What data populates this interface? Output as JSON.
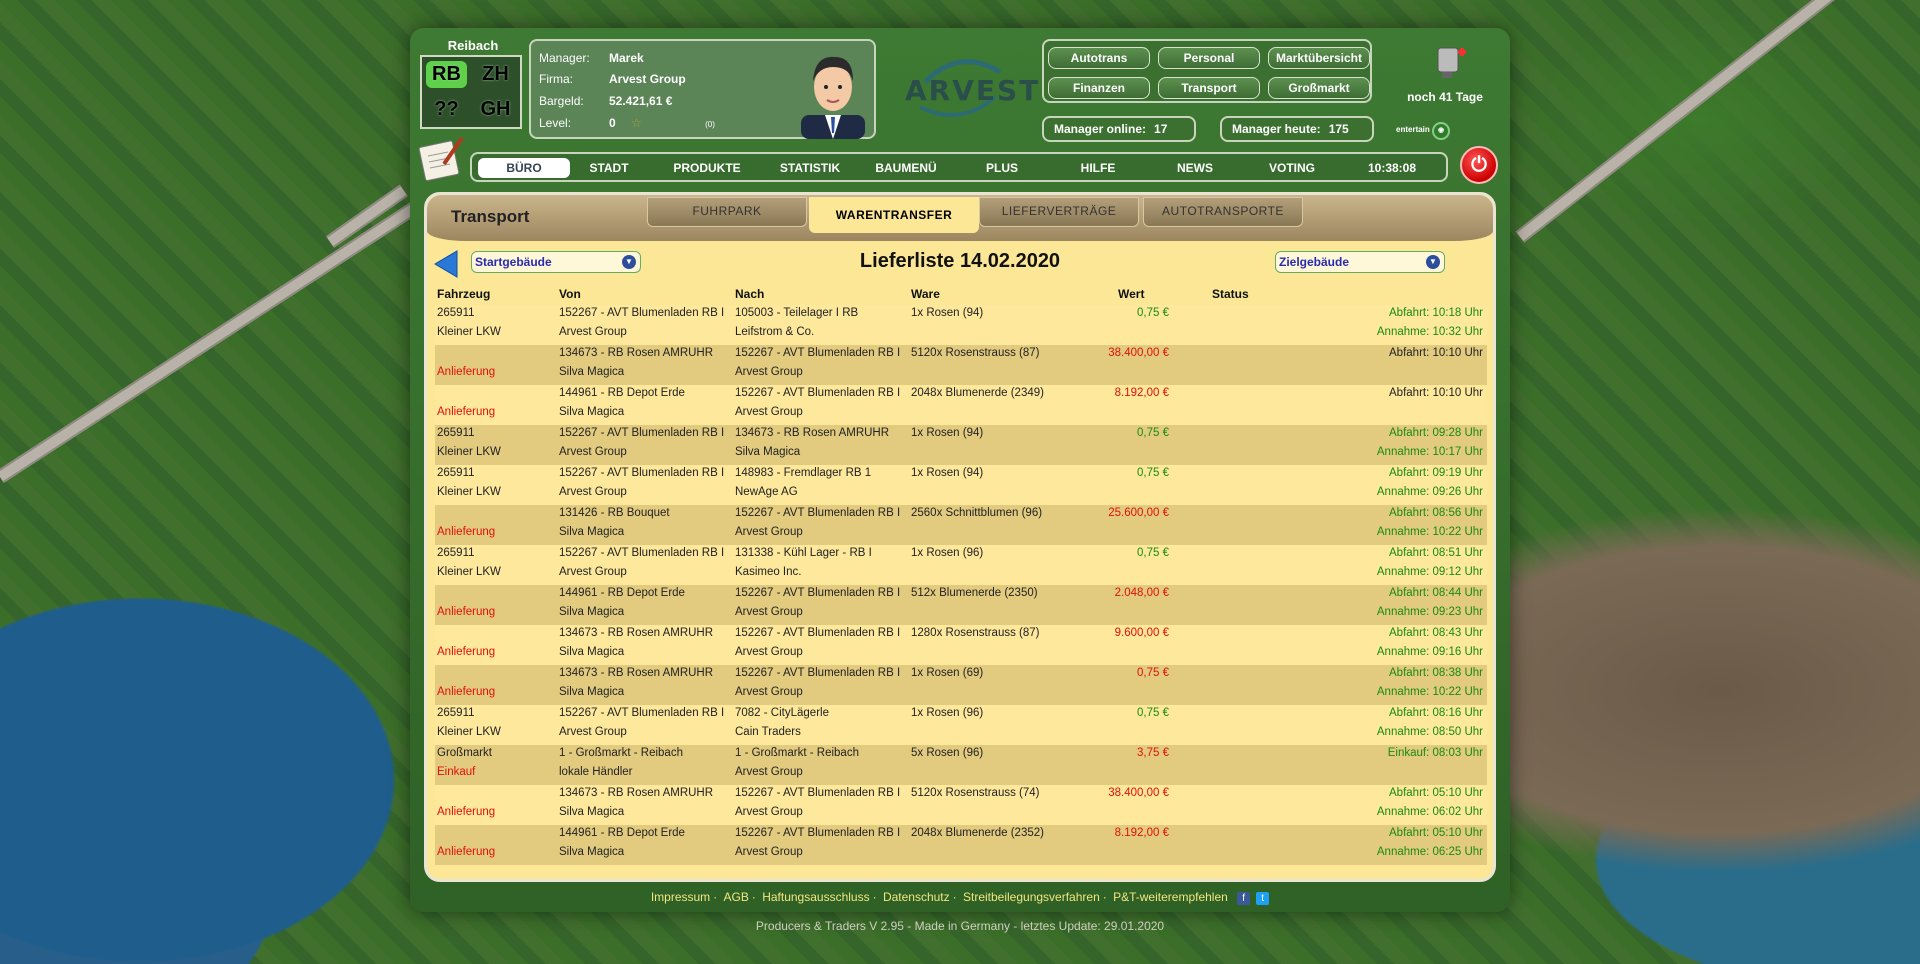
{
  "header": {
    "city": "Reibach",
    "city_grid": [
      "RB",
      "ZH",
      "??",
      "GH"
    ],
    "manager_label": "Manager:",
    "manager": "Marek",
    "company_label": "Firma:",
    "company": "Arvest Group",
    "cash_label": "Bargeld:",
    "cash": "52.421,61 €",
    "level_label": "Level:",
    "level": "0",
    "level_sub": "(0)",
    "logo_text": "ARVEST",
    "top_buttons": [
      "Autotrans",
      "Personal",
      "Marktübersicht",
      "Finanzen",
      "Transport",
      "Großmarkt"
    ],
    "online_label": "Manager online:",
    "online_value": "17",
    "today_label": "Manager heute:",
    "today_value": "175",
    "days_left": "noch 41 Tage",
    "entertain": "entertain"
  },
  "menu": {
    "items": [
      "BÜRO",
      "STADT",
      "PRODUKTE",
      "STATISTIK",
      "BAUMENÜ",
      "PLUS",
      "HILFE",
      "NEWS",
      "VOTING"
    ],
    "clock": "10:38:08"
  },
  "panel": {
    "title": "Transport",
    "tabs": [
      "FUHRPARK",
      "WARENTRANSFER",
      "LIEFERVERTRÄGE",
      "AUTOTRANSPORTE"
    ],
    "start_dropdown": "Startgebäude",
    "target_dropdown": "Zielgebäude",
    "list_title": "Lieferliste 14.02.2020",
    "columns": [
      "Fahrzeug",
      "Von",
      "Nach",
      "Ware",
      "Wert",
      "Status"
    ]
  },
  "rows": [
    {
      "f1": "265911",
      "f2": "Kleiner LKW",
      "v1": "152267 - AVT Blumenladen RB I",
      "v2": "Arvest Group",
      "n1": "105003 - Teilelager I RB",
      "n2": "Leifstrom & Co.",
      "ware": "1x Rosen (94)",
      "wert": "0,75 €",
      "s1": "Abfahrt: 10:18 Uhr",
      "s2": "Annahme: 10:32 Uhr",
      "wc": "green",
      "s1c": "green",
      "s2c": "green",
      "f2c": ""
    },
    {
      "f1": "",
      "f2": "Anlieferung",
      "v1": "134673 - RB Rosen AMRUHR",
      "v2": "Silva Magica",
      "n1": "152267 - AVT Blumenladen RB I",
      "n2": "Arvest Group",
      "ware": "5120x Rosenstrauss (87)",
      "wert": "38.400,00 €",
      "s1": "Abfahrt: 10:10 Uhr",
      "s2": "",
      "wc": "red",
      "s1c": "",
      "s2c": "",
      "f2c": "red"
    },
    {
      "f1": "",
      "f2": "Anlieferung",
      "v1": "144961 - RB Depot Erde",
      "v2": "Silva Magica",
      "n1": "152267 - AVT Blumenladen RB I",
      "n2": "Arvest Group",
      "ware": "2048x Blumenerde (2349)",
      "wert": "8.192,00 €",
      "s1": "Abfahrt: 10:10 Uhr",
      "s2": "",
      "wc": "red",
      "s1c": "",
      "s2c": "",
      "f2c": "red"
    },
    {
      "f1": "265911",
      "f2": "Kleiner LKW",
      "v1": "152267 - AVT Blumenladen RB I",
      "v2": "Arvest Group",
      "n1": "134673 - RB Rosen AMRUHR",
      "n2": "Silva Magica",
      "ware": "1x Rosen (94)",
      "wert": "0,75 €",
      "s1": "Abfahrt: 09:28 Uhr",
      "s2": "Annahme: 10:17 Uhr",
      "wc": "green",
      "s1c": "green",
      "s2c": "green",
      "f2c": ""
    },
    {
      "f1": "265911",
      "f2": "Kleiner LKW",
      "v1": "152267 - AVT Blumenladen RB I",
      "v2": "Arvest Group",
      "n1": "148983 - Fremdlager RB 1",
      "n2": "NewAge AG",
      "ware": "1x Rosen (94)",
      "wert": "0,75 €",
      "s1": "Abfahrt: 09:19 Uhr",
      "s2": "Annahme: 09:26 Uhr",
      "wc": "green",
      "s1c": "green",
      "s2c": "green",
      "f2c": ""
    },
    {
      "f1": "",
      "f2": "Anlieferung",
      "v1": "131426 - RB Bouquet",
      "v2": "Silva Magica",
      "n1": "152267 - AVT Blumenladen RB I",
      "n2": "Arvest Group",
      "ware": "2560x Schnittblumen (96)",
      "wert": "25.600,00 €",
      "s1": "Abfahrt: 08:56 Uhr",
      "s2": "Annahme: 10:22 Uhr",
      "wc": "red",
      "s1c": "green",
      "s2c": "green",
      "f2c": "red"
    },
    {
      "f1": "265911",
      "f2": "Kleiner LKW",
      "v1": "152267 - AVT Blumenladen RB I",
      "v2": "Arvest Group",
      "n1": "131338 - Kühl Lager - RB I",
      "n2": "Kasimeo Inc.",
      "ware": "1x Rosen (96)",
      "wert": "0,75 €",
      "s1": "Abfahrt: 08:51 Uhr",
      "s2": "Annahme: 09:12 Uhr",
      "wc": "green",
      "s1c": "green",
      "s2c": "green",
      "f2c": ""
    },
    {
      "f1": "",
      "f2": "Anlieferung",
      "v1": "144961 - RB Depot Erde",
      "v2": "Silva Magica",
      "n1": "152267 - AVT Blumenladen RB I",
      "n2": "Arvest Group",
      "ware": "512x Blumenerde (2350)",
      "wert": "2.048,00 €",
      "s1": "Abfahrt: 08:44 Uhr",
      "s2": "Annahme: 09:23 Uhr",
      "wc": "red",
      "s1c": "green",
      "s2c": "green",
      "f2c": "red"
    },
    {
      "f1": "",
      "f2": "Anlieferung",
      "v1": "134673 - RB Rosen AMRUHR",
      "v2": "Silva Magica",
      "n1": "152267 - AVT Blumenladen RB I",
      "n2": "Arvest Group",
      "ware": "1280x Rosenstrauss (87)",
      "wert": "9.600,00 €",
      "s1": "Abfahrt: 08:43 Uhr",
      "s2": "Annahme: 09:16 Uhr",
      "wc": "red",
      "s1c": "green",
      "s2c": "green",
      "f2c": "red"
    },
    {
      "f1": "",
      "f2": "Anlieferung",
      "v1": "134673 - RB Rosen AMRUHR",
      "v2": "Silva Magica",
      "n1": "152267 - AVT Blumenladen RB I",
      "n2": "Arvest Group",
      "ware": "1x Rosen (69)",
      "wert": "0,75 €",
      "s1": "Abfahrt: 08:38 Uhr",
      "s2": "Annahme: 10:22 Uhr",
      "wc": "red",
      "s1c": "green",
      "s2c": "green",
      "f2c": "red"
    },
    {
      "f1": "265911",
      "f2": "Kleiner LKW",
      "v1": "152267 - AVT Blumenladen RB I",
      "v2": "Arvest Group",
      "n1": "7082 - CityLägerle",
      "n2": "Cain Traders",
      "ware": "1x Rosen (96)",
      "wert": "0,75 €",
      "s1": "Abfahrt: 08:16 Uhr",
      "s2": "Annahme: 08:50 Uhr",
      "wc": "green",
      "s1c": "green",
      "s2c": "green",
      "f2c": ""
    },
    {
      "f1": "Großmarkt",
      "f2": "Einkauf",
      "v1": "1 - Großmarkt - Reibach",
      "v2": "lokale Händler",
      "n1": "1 - Großmarkt - Reibach",
      "n2": "Arvest Group",
      "ware": "5x Rosen (96)",
      "wert": "3,75 €",
      "s1": "Einkauf: 08:03 Uhr",
      "s2": "",
      "wc": "red",
      "s1c": "green",
      "s2c": "",
      "f2c": "red"
    },
    {
      "f1": "",
      "f2": "Anlieferung",
      "v1": "134673 - RB Rosen AMRUHR",
      "v2": "Silva Magica",
      "n1": "152267 - AVT Blumenladen RB I",
      "n2": "Arvest Group",
      "ware": "5120x Rosenstrauss (74)",
      "wert": "38.400,00 €",
      "s1": "Abfahrt: 05:10 Uhr",
      "s2": "Annahme: 06:02 Uhr",
      "wc": "red",
      "s1c": "green",
      "s2c": "green",
      "f2c": "red"
    },
    {
      "f1": "",
      "f2": "Anlieferung",
      "v1": "144961 - RB Depot Erde",
      "v2": "Silva Magica",
      "n1": "152267 - AVT Blumenladen RB I",
      "n2": "Arvest Group",
      "ware": "2048x Blumenerde (2352)",
      "wert": "8.192,00 €",
      "s1": "Abfahrt: 05:10 Uhr",
      "s2": "Annahme: 06:25 Uhr",
      "wc": "red",
      "s1c": "green",
      "s2c": "green",
      "f2c": "red"
    }
  ],
  "footer": {
    "links": [
      "Impressum",
      "AGB",
      "Haftungsausschluss",
      "Datenschutz",
      "Streitbeilegungsverfahren",
      "P&T-weiterempfehlen"
    ],
    "copyright": "Producers & Traders V 2.95 - Made in Germany - letztes Update: 29.01.2020"
  }
}
